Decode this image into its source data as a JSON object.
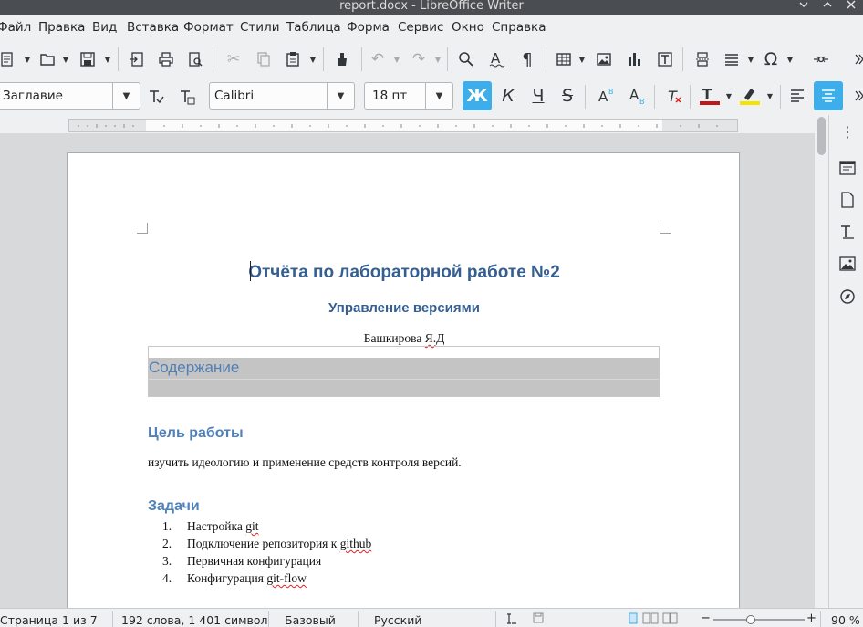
{
  "window": {
    "title": "report.docx - LibreOffice Writer",
    "controls": [
      "chevron-down-icon",
      "chevron-up-icon",
      "close-icon"
    ]
  },
  "menu": [
    "Файл",
    "Правка",
    "Вид",
    "Вставка",
    "Формат",
    "Стили",
    "Таблица",
    "Форма",
    "Сервис",
    "Окно",
    "Справка"
  ],
  "toolbar": {
    "paragraph_style": "Заглавие",
    "font_name": "Calibri",
    "font_size": "18 пт",
    "bold_label": "Ж",
    "italic_label": "К",
    "underline_label": "Ч",
    "strike_label": "S",
    "font_color": "#c0171a",
    "highlight_color": "#f5e400",
    "accent": "#3daee9"
  },
  "document": {
    "title": "Отчёта по лабораторной работе №2",
    "subtitle": "Управление версиями",
    "author_pre": "Башкирова ",
    "author_sq": "Я.Д",
    "toc_title": "Содержание",
    "goal_heading": "Цель работы",
    "goal_text": "изучить идеологию и применение средств контроля версий.",
    "tasks_heading": "Задачи",
    "tasks": [
      {
        "num": "1.",
        "pre": "Настройка ",
        "sq": "git"
      },
      {
        "num": "2.",
        "pre": "Подключение репозитория к ",
        "sq": "github"
      },
      {
        "num": "3.",
        "pre": "Первичная конфигурация",
        "sq": ""
      },
      {
        "num": "4.",
        "pre": "Конфигурация ",
        "sq": "git-flow"
      }
    ]
  },
  "status": {
    "page": "Страница 1 из 7",
    "words": "192 слова, 1 401 символ",
    "page_style": "Базовый",
    "language": "Русский",
    "zoom": "90 %",
    "zoom_minus": "−",
    "zoom_plus": "+"
  }
}
